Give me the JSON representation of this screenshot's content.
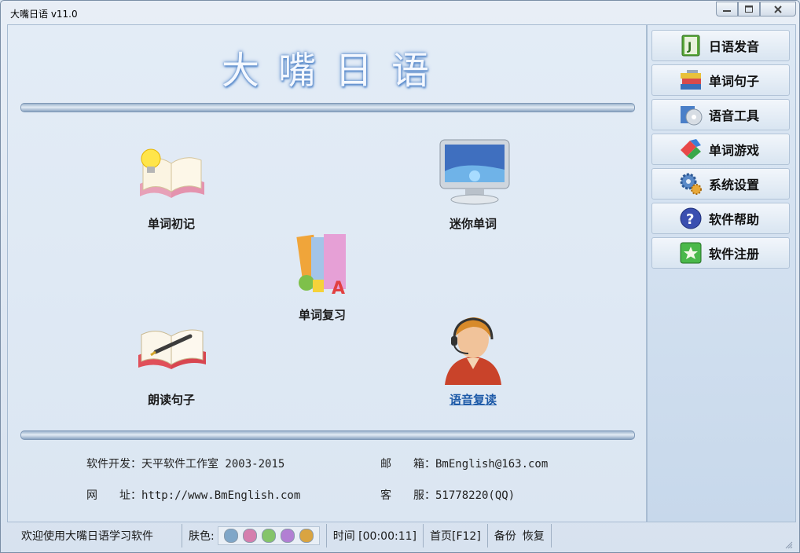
{
  "window": {
    "title": "大嘴日语 v11.0"
  },
  "main": {
    "title": "大嘴日语",
    "features": [
      {
        "id": "word-learn",
        "label": "单词初记",
        "icon": "book-bulb-icon"
      },
      {
        "id": "mini-word",
        "label": "迷你单词",
        "icon": "monitor-icon"
      },
      {
        "id": "word-review",
        "label": "单词复习",
        "icon": "books-abc-icon"
      },
      {
        "id": "read-sentence",
        "label": "朗读句子",
        "icon": "book-pen-icon"
      },
      {
        "id": "voice-repeat",
        "label": "语音复读",
        "icon": "headset-person-icon"
      }
    ],
    "info": {
      "developer": "软件开发：天平软件工作室 2003-2015",
      "email_label": "邮　　箱：BmEnglish@163.com",
      "website": "网　　址：http://www.BmEnglish.com",
      "service": "客　　服：51778220(QQ)"
    }
  },
  "sidebar": {
    "items": [
      {
        "label": "日语发音",
        "icon": "green-book-j-icon"
      },
      {
        "label": "单词句子",
        "icon": "book-stack-icon"
      },
      {
        "label": "语音工具",
        "icon": "media-cd-icon"
      },
      {
        "label": "单词游戏",
        "icon": "puzzle-blocks-icon"
      },
      {
        "label": "系统设置",
        "icon": "gears-icon"
      },
      {
        "label": "软件帮助",
        "icon": "help-question-icon"
      },
      {
        "label": "软件注册",
        "icon": "star-register-icon"
      }
    ]
  },
  "status": {
    "welcome": "欢迎使用大嘴日语学习软件",
    "skin_label": "肤色:",
    "skin_colors": [
      "#7fa6c8",
      "#d57fae",
      "#85c46a",
      "#b27fd3",
      "#d9a441"
    ],
    "time": "时间 [00:00:11]",
    "home": "首页[F12]",
    "backup": "备份",
    "restore": "恢复"
  }
}
